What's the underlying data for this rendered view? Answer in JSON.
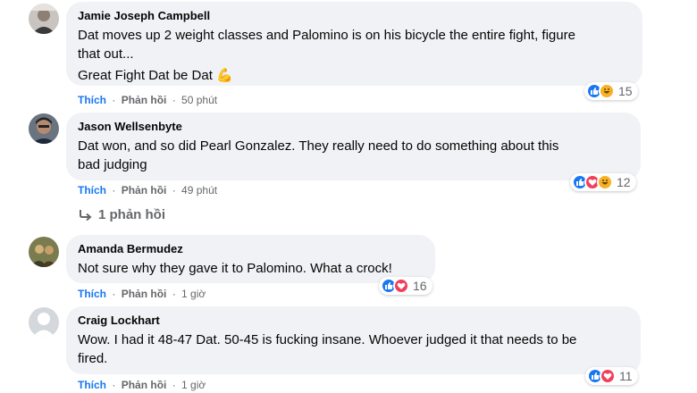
{
  "comments": [
    {
      "author": "Jamie Joseph Campbell",
      "lines": [
        "Dat moves up 2 weight classes and Palomino is on his bicycle the entire fight, figure",
        "that out...",
        "Great Fight Dat be Dat 💪"
      ],
      "like_label": "Thích",
      "reply_label": "Phản hồi",
      "time": "50 phút",
      "reaction_count": "15",
      "reaction_icons": [
        "like-icon",
        "haha-icon"
      ]
    },
    {
      "author": "Jason Wellsenbyte",
      "lines": [
        "Dat won, and so did Pearl Gonzalez. They really need to do something about this",
        "bad judging"
      ],
      "like_label": "Thích",
      "reply_label": "Phản hồi",
      "time": "49 phút",
      "reaction_count": "12",
      "reaction_icons": [
        "like-icon",
        "love-icon",
        "haha-icon"
      ],
      "replies_label": "1 phản hồi"
    },
    {
      "author": "Amanda Bermudez",
      "lines": [
        "Not sure why they gave it to Palomino. What a crock!"
      ],
      "like_label": "Thích",
      "reply_label": "Phản hồi",
      "time": "1 giờ",
      "reaction_count": "16",
      "reaction_icons": [
        "like-icon",
        "love-icon"
      ]
    },
    {
      "author": "Craig Lockhart",
      "lines": [
        "Wow. I had it 48-47 Dat. 50-45 is fucking insane. Whoever judged it that needs to be",
        "fired."
      ],
      "like_label": "Thích",
      "reply_label": "Phản hồi",
      "time": "1 giờ",
      "reaction_count": "11",
      "reaction_icons": [
        "like-icon",
        "love-icon"
      ]
    }
  ],
  "separator": "·",
  "colors": {
    "bubble": "#f0f2f5",
    "like_text": "#1877f2",
    "meta_text": "#65676b",
    "like_icon": "#1877f2",
    "love_icon": "#f33e58",
    "haha_icon": "#f7b125"
  }
}
